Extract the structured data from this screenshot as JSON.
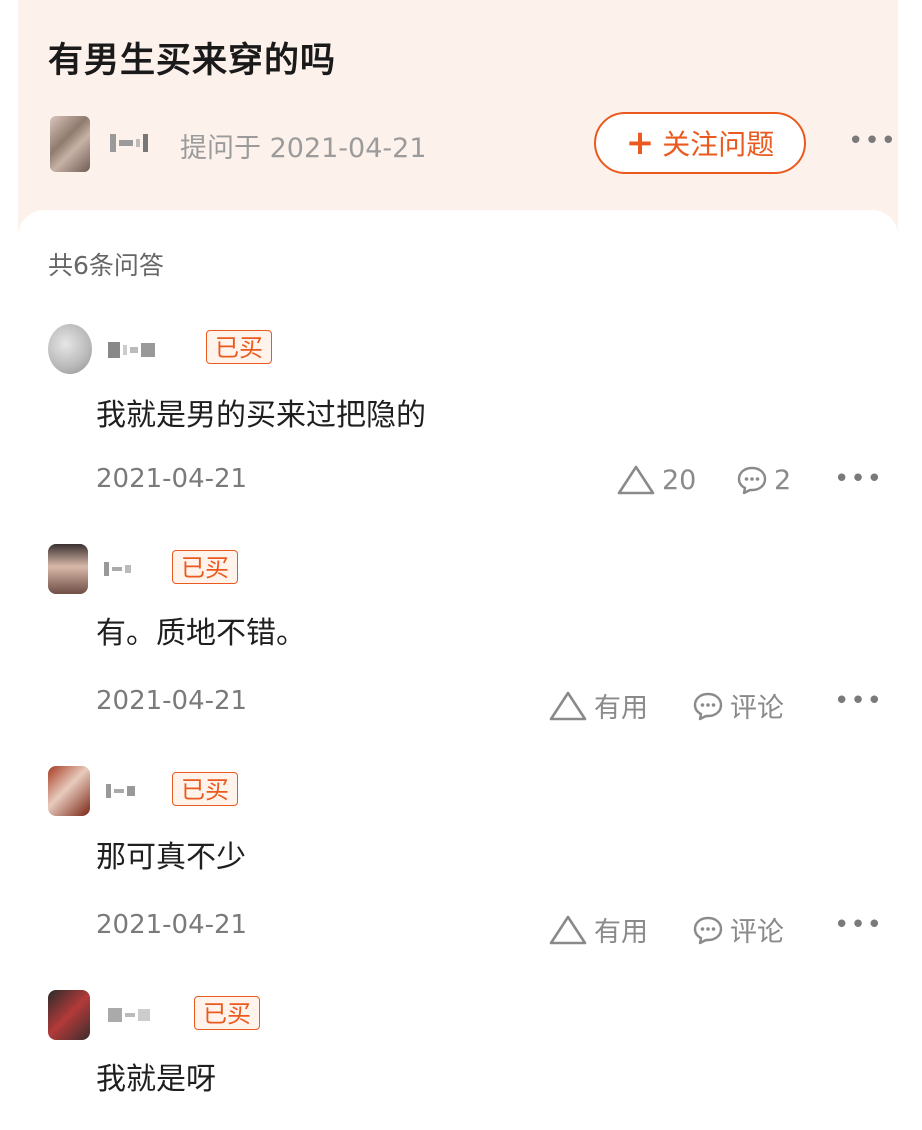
{
  "question": {
    "title": "有男生买来穿的吗",
    "asked_at": "提问于 2021-04-21",
    "follow_label": "关注问题"
  },
  "answers_count": "共6条问答",
  "bought_badge": "已买",
  "more_label": "•••",
  "answers": [
    {
      "text": "我就是男的买来过把隐的",
      "date": "2021-04-21",
      "useful": "20",
      "comment": "2"
    },
    {
      "text": "有。质地不错。",
      "date": "2021-04-21",
      "useful": "有用",
      "comment": "评论"
    },
    {
      "text": "那可真不少",
      "date": "2021-04-21",
      "useful": "有用",
      "comment": "评论"
    },
    {
      "text": "我就是呀"
    }
  ],
  "colors": {
    "accent": "#ea5a1f",
    "header_bg": "#fdf1ec"
  }
}
